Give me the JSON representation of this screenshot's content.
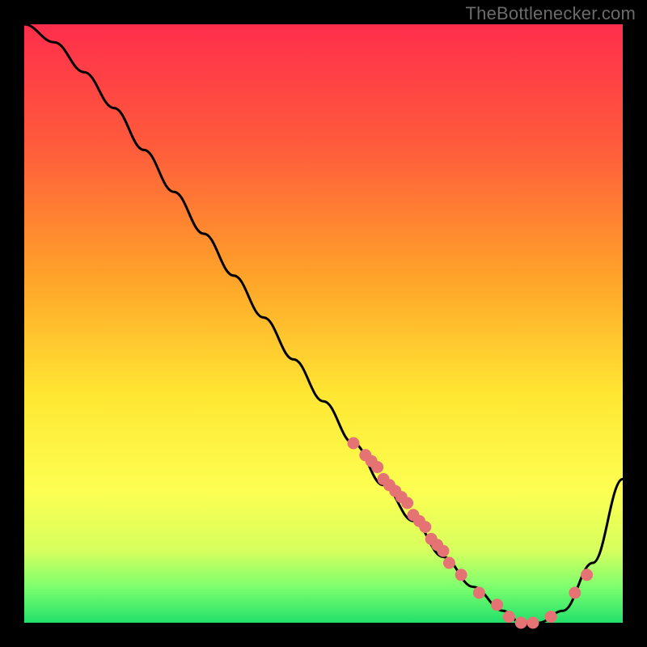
{
  "watermark": "TheBottlenecker.com",
  "colors": {
    "bg": "#000000",
    "curve": "#000000",
    "dots": "#e57373",
    "gradient_stops": [
      {
        "offset": 0.0,
        "color": "#ff2e4c"
      },
      {
        "offset": 0.2,
        "color": "#ff5a3c"
      },
      {
        "offset": 0.42,
        "color": "#ffa229"
      },
      {
        "offset": 0.62,
        "color": "#ffe733"
      },
      {
        "offset": 0.78,
        "color": "#fdff52"
      },
      {
        "offset": 0.88,
        "color": "#d6ff5e"
      },
      {
        "offset": 0.94,
        "color": "#7dff6e"
      },
      {
        "offset": 1.0,
        "color": "#22e06a"
      }
    ]
  },
  "chart_data": {
    "type": "line",
    "title": "",
    "xlabel": "",
    "ylabel": "",
    "ylim": [
      0,
      100
    ],
    "xlim": [
      0,
      100
    ],
    "series": [
      {
        "name": "bottleneck-curve",
        "x": [
          0,
          5,
          10,
          15,
          20,
          25,
          30,
          35,
          40,
          45,
          50,
          55,
          60,
          65,
          70,
          75,
          80,
          83,
          86,
          90,
          95,
          100
        ],
        "y": [
          100,
          97,
          92,
          86,
          79,
          72,
          65,
          58,
          51,
          44,
          37,
          30,
          23,
          17,
          11,
          6,
          2,
          0,
          0,
          2,
          10,
          24
        ]
      }
    ],
    "highlight_points": {
      "name": "highlight-dots",
      "x": [
        55,
        57,
        58,
        59,
        60,
        61,
        62,
        63,
        64,
        65,
        66,
        67,
        68,
        69,
        70,
        71,
        73,
        76,
        79,
        81,
        83,
        85,
        88,
        92,
        94
      ],
      "y": [
        30,
        28,
        27,
        26,
        24,
        23,
        22,
        21,
        20,
        18,
        17,
        16,
        14,
        13,
        12,
        10,
        8,
        5,
        3,
        1,
        0,
        0,
        1,
        5,
        8
      ]
    }
  }
}
